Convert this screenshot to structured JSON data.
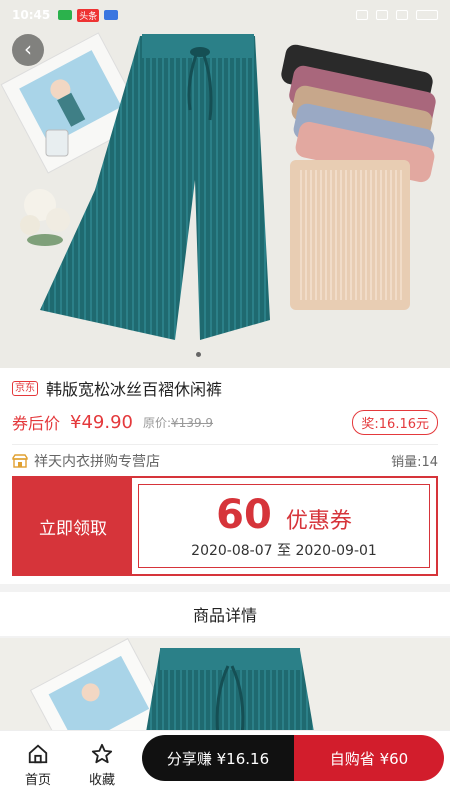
{
  "status": {
    "time": "10:45",
    "badge": "头条"
  },
  "product": {
    "tag": "京东",
    "title": "韩版宽松冰丝百褶休闲裤",
    "price_label": "券后价",
    "price": "¥49.90",
    "orig_label": "原价:",
    "orig_price": "¥139.9",
    "reward": "奖:16.16元",
    "shop": "祥天内衣拼购专营店",
    "sales": "销量:14"
  },
  "coupon": {
    "action": "立即领取",
    "amount": "60",
    "type": "优惠券",
    "start": "2020-08-07",
    "sep": "至",
    "end": "2020-09-01"
  },
  "details": {
    "title": "商品详情"
  },
  "bottom": {
    "home": "首页",
    "favorite": "收藏",
    "share": "分享赚 ¥16.16",
    "buy": "自购省 ¥60"
  },
  "colors": {
    "accent": "#d6343a",
    "buy": "#d21d2c",
    "share": "#111111",
    "pants": "#1f6a70"
  }
}
